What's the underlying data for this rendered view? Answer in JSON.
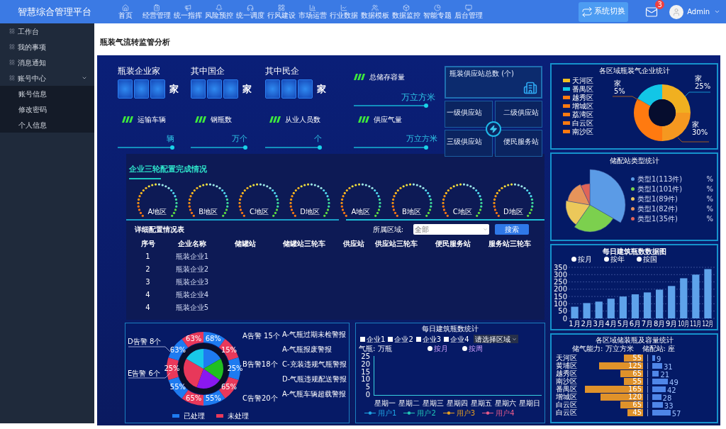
{
  "header": {
    "title": "智慧综合管理平台",
    "nav": [
      {
        "label": "首页"
      },
      {
        "label": "经营管理"
      },
      {
        "label": "统一指挥"
      },
      {
        "label": "风险预控"
      },
      {
        "label": "统一调度"
      },
      {
        "label": "行风建设"
      },
      {
        "label": "市场运营"
      },
      {
        "label": "行业数据"
      },
      {
        "label": "数据模板"
      },
      {
        "label": "数据监控"
      },
      {
        "label": "智能专题"
      },
      {
        "label": "后台管理"
      }
    ],
    "switch_button": "系统切换",
    "mail_badge": "3",
    "user": "Admin"
  },
  "sidebar": {
    "items": [
      {
        "label": "工作台"
      },
      {
        "label": "我的事项"
      },
      {
        "label": "消息通知"
      },
      {
        "label": "账号中心",
        "expanded": true,
        "children": [
          {
            "label": "账号信息"
          },
          {
            "label": "修改密码"
          },
          {
            "label": "个人信息"
          }
        ]
      }
    ]
  },
  "page_title": "瓶装气流转监管分析",
  "stats": {
    "companies": [
      {
        "label": "瓶装企业家",
        "unit": "家"
      },
      {
        "label": "其中国企",
        "unit": "家"
      },
      {
        "label": "其中民企",
        "unit": "家"
      }
    ],
    "storage": {
      "label": "总储存容量",
      "unit": "万立方米"
    },
    "metrics": [
      {
        "label": "运输车辆",
        "unit": "辆"
      },
      {
        "label": "钢瓶数",
        "unit": "万个"
      },
      {
        "label": "从业人员数",
        "unit": "个"
      },
      {
        "label": "供应气量",
        "unit": "万立方米"
      }
    ]
  },
  "supply": {
    "title": "瓶装供应站总数 (个)",
    "tiles": [
      "一级供应站",
      "二级供应站",
      "三级供应站",
      "便民服务站"
    ]
  },
  "config": {
    "title": "企业三轮配置完成情况",
    "regions": [
      "A地区",
      "B地区",
      "C地区",
      "D地区",
      "A地区",
      "B地区",
      "C地区",
      "D地区"
    ]
  },
  "table": {
    "title": "详细配置情况表",
    "filter_label": "所属区域:",
    "filter_placeholder": "全部",
    "search_button": "搜索",
    "columns": [
      "序号",
      "企业名称",
      "储罐站",
      "储罐站三轮车",
      "供应站",
      "供应站三轮车",
      "便民服务站",
      "服务站三轮车"
    ],
    "rows": [
      [
        "1",
        "瓶装企业1"
      ],
      [
        "2",
        "瓶装企业2"
      ],
      [
        "3",
        "瓶装企业3"
      ],
      [
        "4",
        "瓶装企业4"
      ],
      [
        "4",
        "瓶装企业5"
      ]
    ]
  },
  "alarm_chart": {
    "left_callouts": [
      "D告警 8个",
      "E告警 6个"
    ],
    "right_callouts": [
      "A告警 15个",
      "B告警18个",
      "C告警20个"
    ],
    "ring_labels": [
      "68%",
      "15%",
      "25%",
      "65%",
      "55%",
      "65%",
      "55%",
      "25%",
      "63%",
      "63%"
    ],
    "alerts": [
      "A-气瓶过期未检警报",
      "A-气瓶报废警报",
      "C-充装违规气瓶警报",
      "D-气瓶违规配送警报",
      "A-气瓶车辆超载警报"
    ],
    "legend": [
      {
        "label": "已处理",
        "color": "#1e7bf0"
      },
      {
        "label": "未处理",
        "color": "#e8385a"
      }
    ]
  },
  "weekly_chart": {
    "title": "每日建筑瓶数统计",
    "checkboxes": [
      {
        "label": "企业1",
        "checked": false
      },
      {
        "label": "企业2",
        "checked": false
      },
      {
        "label": "企业3",
        "checked": false
      },
      {
        "label": "企业4",
        "checked": false
      }
    ],
    "region_select": "请选择区域",
    "unit": "气瓶: 万瓶",
    "toggles": [
      "按月",
      "按周"
    ],
    "yticks": [
      "25",
      "20",
      "15",
      "10",
      "5",
      "0"
    ],
    "days": [
      "星期一",
      "星期二",
      "星期三",
      "星期四",
      "星期五",
      "星期六",
      "星期日"
    ],
    "legend": [
      {
        "label": "用户1",
        "color": "#1fa8e8"
      },
      {
        "label": "用户2",
        "color": "#21c8b8"
      },
      {
        "label": "用户3",
        "color": "#e8a020"
      },
      {
        "label": "用户4",
        "color": "#e85a8a"
      }
    ]
  },
  "district_donut": {
    "title": "各区域瓶装气企业统计",
    "legend": [
      {
        "label": "天河区",
        "color": "#f0c020"
      },
      {
        "label": "番禺区",
        "color": "#10c8e8"
      },
      {
        "label": "越秀区",
        "color": "#ff7a10"
      },
      {
        "label": "增城区",
        "color": "#ff7a10"
      },
      {
        "label": "荔湾区",
        "color": "#ff7a10"
      },
      {
        "label": "白云区",
        "color": "#ff7a10"
      },
      {
        "label": "南沙区",
        "color": "#ff7a10"
      }
    ],
    "labels": [
      {
        "name": "家",
        "share": "5%"
      },
      {
        "name": "家",
        "share": "25%"
      },
      {
        "name": "家",
        "share": "30%"
      }
    ]
  },
  "station_pie": {
    "title": "储配站类型统计",
    "legend": [
      {
        "label": "类型1(113件)",
        "color": "#5b9be6",
        "share": "%"
      },
      {
        "label": "类型1(101件)",
        "color": "#7cd04e",
        "share": "%"
      },
      {
        "label": "类型1(89件)",
        "color": "#ecc85a",
        "share": "%"
      },
      {
        "label": "类型1(82件)",
        "color": "#e6945a",
        "share": "%"
      },
      {
        "label": "类型1(35件)",
        "color": "#e06458",
        "share": "%"
      }
    ]
  },
  "monthly_chart": {
    "title": "每日建筑瓶数数据图",
    "legend": [
      "按月",
      "按年",
      "按国"
    ],
    "chart_data": {
      "type": "bar",
      "categories": [
        "1月",
        "2月",
        "3月",
        "4月",
        "5月",
        "6月",
        "7月",
        "8月",
        "9月",
        "10月",
        "11月",
        "12月"
      ],
      "values": [
        80,
        105,
        115,
        135,
        150,
        165,
        178,
        197,
        222,
        275,
        300,
        338
      ],
      "ylim": [
        0,
        350
      ],
      "yticks": [
        0,
        50,
        100,
        150,
        200,
        250,
        300,
        350
      ],
      "grid": true
    }
  },
  "capacity_chart": {
    "title": "各区域储装瓶及容量统计",
    "units": [
      "储气能力: 万立方米",
      "储配站: 座"
    ],
    "rows": [
      {
        "district": "天河区",
        "capacity": "55",
        "stations": "9"
      },
      {
        "district": "黄埔区",
        "capacity": "125",
        "stations": "31"
      },
      {
        "district": "越秀区",
        "capacity": "65",
        "stations": "21"
      },
      {
        "district": "南沙区",
        "capacity": "55",
        "stations": "49"
      },
      {
        "district": "番禺区",
        "capacity": "165",
        "stations": "42"
      },
      {
        "district": "增城区",
        "capacity": "120",
        "stations": "28"
      },
      {
        "district": "白云区",
        "capacity": "65",
        "stations": "33"
      },
      {
        "district": "白云区",
        "capacity": "45",
        "stations": "57"
      }
    ]
  }
}
